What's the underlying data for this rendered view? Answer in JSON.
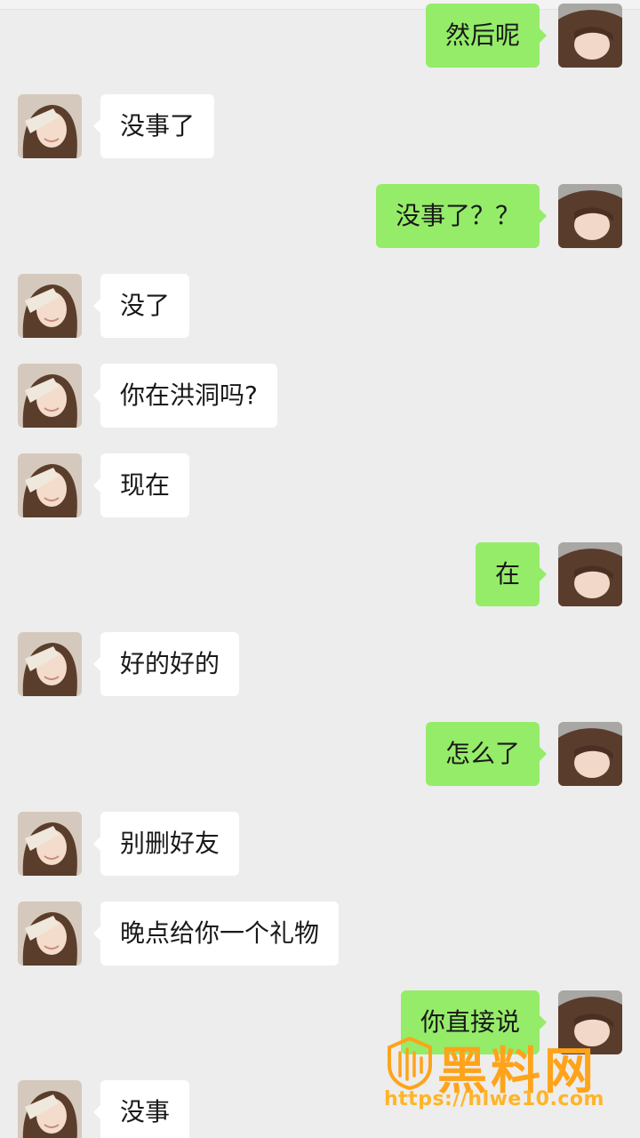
{
  "header": {
    "time_text": ""
  },
  "messages": [
    {
      "side": "right",
      "text": "然后呢"
    },
    {
      "side": "left",
      "text": "没事了"
    },
    {
      "side": "right",
      "text": "没事了？？"
    },
    {
      "side": "left",
      "text": "没了"
    },
    {
      "side": "left",
      "text": "你在洪洞吗?"
    },
    {
      "side": "left",
      "text": "现在"
    },
    {
      "side": "right",
      "text": "在"
    },
    {
      "side": "left",
      "text": "好的好的"
    },
    {
      "side": "right",
      "text": "怎么了"
    },
    {
      "side": "left",
      "text": "别删好友"
    },
    {
      "side": "left",
      "text": "晚点给你一个礼物"
    },
    {
      "side": "right",
      "text": "你直接说"
    },
    {
      "side": "left",
      "text": "没事"
    }
  ],
  "colors": {
    "background": "#ededed",
    "incoming_bubble": "#ffffff",
    "outgoing_bubble": "#95ec69",
    "watermark": "#ffa31a"
  },
  "watermark": {
    "title": "黑料网",
    "url": "https://hlwe10.com",
    "icon": "shield-logo-icon"
  }
}
